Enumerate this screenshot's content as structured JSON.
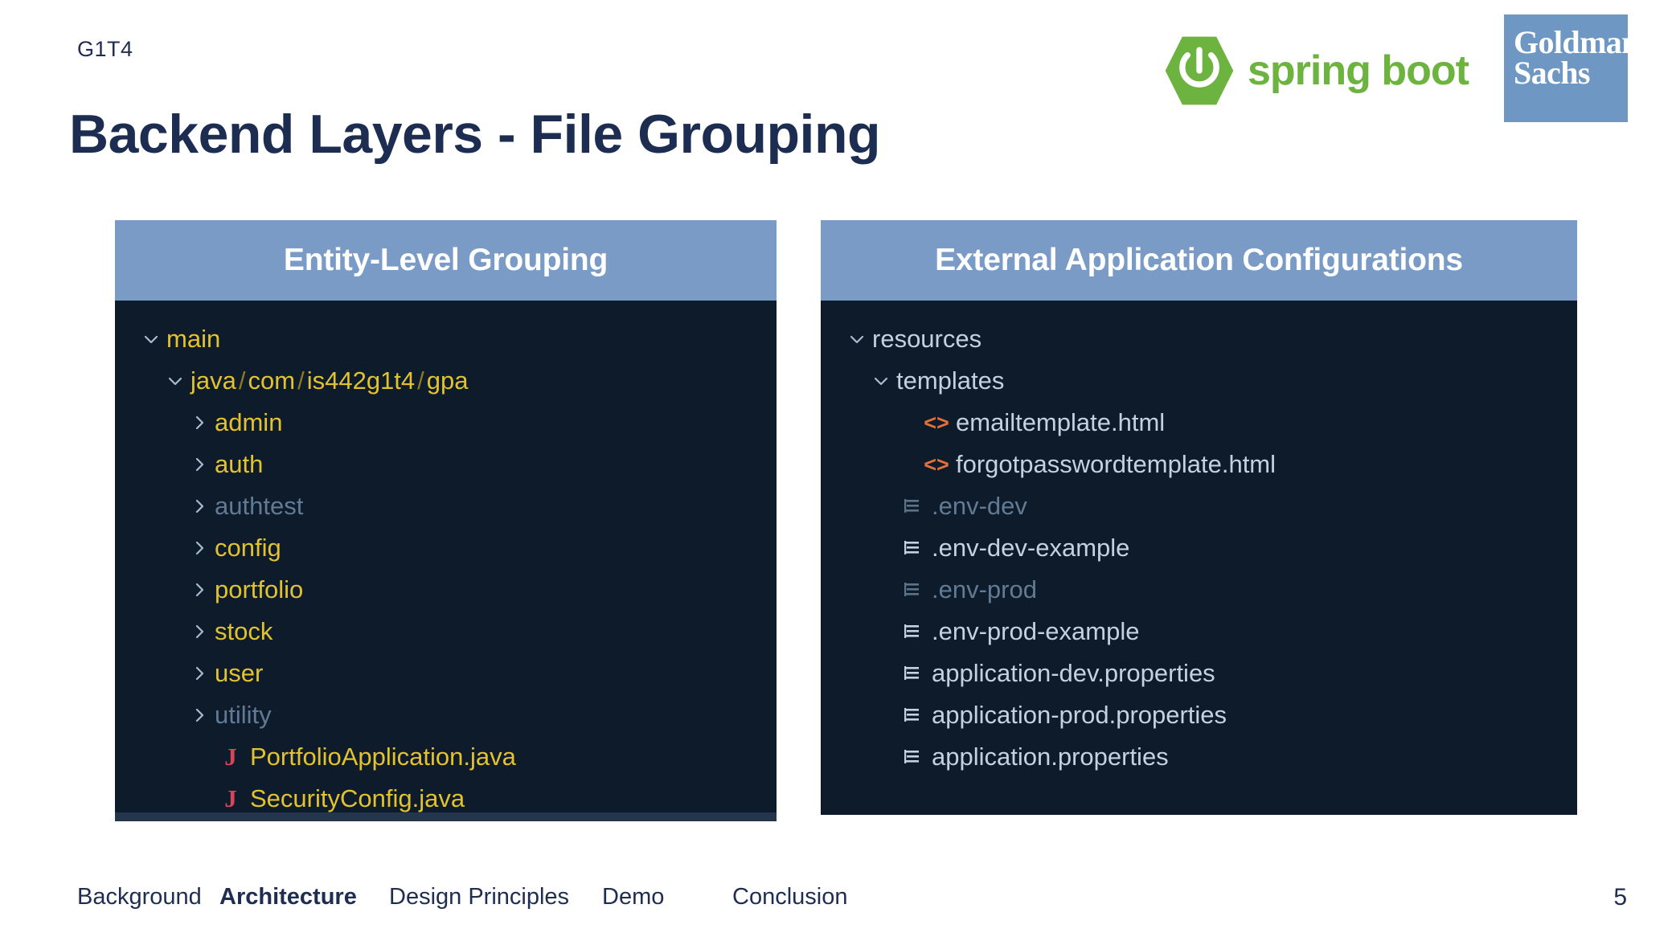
{
  "slide": {
    "tag": "G1T4",
    "title": "Backend Layers - File Grouping",
    "page_number": "5"
  },
  "logos": {
    "spring_boot": {
      "text": "spring boot",
      "icon": "spring-boot-leaf-icon",
      "color": "#6db33f"
    },
    "goldman_sachs": {
      "line1": "Goldman",
      "line2": "Sachs",
      "color": "#6f97c4"
    }
  },
  "panels": [
    {
      "id": "entity-level-grouping",
      "header": "Entity-Level Grouping",
      "header_color": "#7a9bc6",
      "body_color": "#0d1b2a",
      "rows": [
        {
          "label": "main",
          "indent": 0,
          "twisty": "chevron-down-icon",
          "icon": null,
          "tone": "gold"
        },
        {
          "label": "java/com/is442g1t4/gpa",
          "indent": 1,
          "twisty": "chevron-down-icon",
          "icon": null,
          "tone": "gold-path"
        },
        {
          "label": "admin",
          "indent": 2,
          "twisty": "chevron-right-icon",
          "icon": null,
          "tone": "gold"
        },
        {
          "label": "auth",
          "indent": 2,
          "twisty": "chevron-right-icon",
          "icon": null,
          "tone": "gold"
        },
        {
          "label": "authtest",
          "indent": 2,
          "twisty": "chevron-right-icon",
          "icon": null,
          "tone": "dim"
        },
        {
          "label": "config",
          "indent": 2,
          "twisty": "chevron-right-icon",
          "icon": null,
          "tone": "gold"
        },
        {
          "label": "portfolio",
          "indent": 2,
          "twisty": "chevron-right-icon",
          "icon": null,
          "tone": "gold"
        },
        {
          "label": "stock",
          "indent": 2,
          "twisty": "chevron-right-icon",
          "icon": null,
          "tone": "gold"
        },
        {
          "label": "user",
          "indent": 2,
          "twisty": "chevron-right-icon",
          "icon": null,
          "tone": "gold"
        },
        {
          "label": "utility",
          "indent": 2,
          "twisty": "chevron-right-icon",
          "icon": null,
          "tone": "dim"
        },
        {
          "label": "PortfolioApplication.java",
          "indent": 2,
          "twisty": null,
          "icon": "java-file-icon",
          "tone": "gold"
        },
        {
          "label": "SecurityConfig.java",
          "indent": 2,
          "twisty": null,
          "icon": "java-file-icon",
          "tone": "gold"
        }
      ]
    },
    {
      "id": "external-application-configurations",
      "header": "External Application Configurations",
      "header_color": "#7a9bc6",
      "body_color": "#0d1b2a",
      "rows": [
        {
          "label": "resources",
          "indent": 0,
          "twisty": "chevron-down-icon",
          "icon": null,
          "tone": "light"
        },
        {
          "label": "templates",
          "indent": 1,
          "twisty": "chevron-down-icon",
          "icon": null,
          "tone": "light"
        },
        {
          "label": "emailtemplate.html",
          "indent": 2,
          "twisty": null,
          "icon": "html-file-icon",
          "tone": "light"
        },
        {
          "label": "forgotpasswordtemplate.html",
          "indent": 2,
          "twisty": null,
          "icon": "html-file-icon",
          "tone": "light"
        },
        {
          "label": ".env-dev",
          "indent": 1,
          "twisty": null,
          "icon": "config-file-icon",
          "tone": "dim"
        },
        {
          "label": ".env-dev-example",
          "indent": 1,
          "twisty": null,
          "icon": "config-file-icon",
          "tone": "light"
        },
        {
          "label": ".env-prod",
          "indent": 1,
          "twisty": null,
          "icon": "config-file-icon",
          "tone": "dim"
        },
        {
          "label": ".env-prod-example",
          "indent": 1,
          "twisty": null,
          "icon": "config-file-icon",
          "tone": "light"
        },
        {
          "label": "application-dev.properties",
          "indent": 1,
          "twisty": null,
          "icon": "config-file-icon",
          "tone": "light"
        },
        {
          "label": "application-prod.properties",
          "indent": 1,
          "twisty": null,
          "icon": "config-file-icon",
          "tone": "light"
        },
        {
          "label": "application.properties",
          "indent": 1,
          "twisty": null,
          "icon": "config-file-icon",
          "tone": "light"
        }
      ]
    }
  ],
  "footer": {
    "nav": [
      {
        "label": "Background",
        "active": false
      },
      {
        "label": "Architecture",
        "active": true
      },
      {
        "label": "Design Principles",
        "active": false
      },
      {
        "label": "Demo",
        "active": false
      },
      {
        "label": "Conclusion",
        "active": false
      }
    ]
  },
  "colors": {
    "title": "#1d2d51",
    "panel_header": "#7a9bc6",
    "panel_body": "#0d1b2a",
    "folder_gold": "#e3c230",
    "dimmed_gray": "#617b95",
    "file_light": "#c3d2e0",
    "java_icon": "#d6455a",
    "html_icon": "#e2703a",
    "spring_green": "#6db33f"
  }
}
